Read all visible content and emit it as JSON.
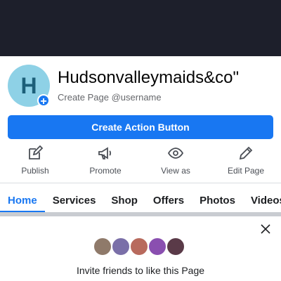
{
  "page": {
    "avatar_letter": "H",
    "name": "Hudsonvalleymaids&co\"",
    "username_prompt": "Create Page @username",
    "action_button_label": "Create Action Button"
  },
  "actions": [
    {
      "label": "Publish",
      "icon": "pencil-square-icon"
    },
    {
      "label": "Promote",
      "icon": "megaphone-icon"
    },
    {
      "label": "View as",
      "icon": "eye-icon"
    },
    {
      "label": "Edit Page",
      "icon": "pencil-icon"
    }
  ],
  "tabs": [
    {
      "label": "Home",
      "active": true
    },
    {
      "label": "Services",
      "active": false
    },
    {
      "label": "Shop",
      "active": false
    },
    {
      "label": "Offers",
      "active": false
    },
    {
      "label": "Photos",
      "active": false
    },
    {
      "label": "Videos",
      "active": false
    }
  ],
  "invite": {
    "text": "Invite friends to like this Page",
    "friend_avatar_colors": [
      "#8f7a6a",
      "#7a6fa8",
      "#b86a5d",
      "#8a4fb0",
      "#5a3a48"
    ]
  },
  "colors": {
    "accent": "#1877f2",
    "cover": "#1d1f2b",
    "avatar_bg": "#8ed1e6"
  }
}
